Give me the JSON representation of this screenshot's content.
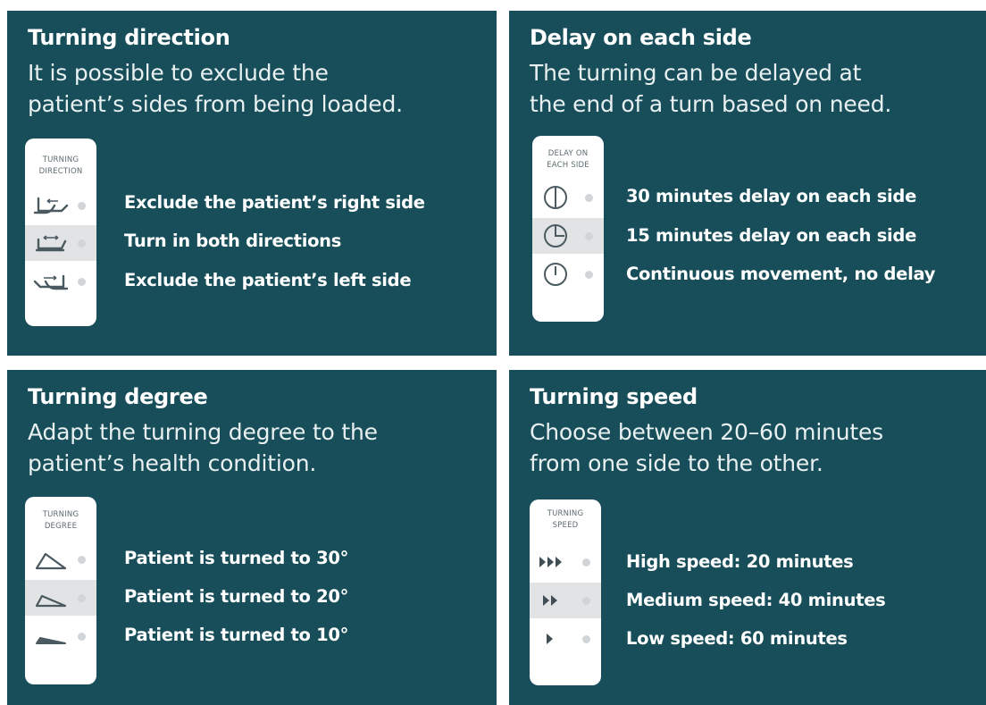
{
  "panels": {
    "direction": {
      "title": "Turning direction",
      "desc": [
        "It is possible to exclude the",
        "patient’s sides from being loaded."
      ],
      "card_header": [
        "TURNING",
        "DIRECTION"
      ],
      "options": [
        {
          "label": "Exclude the patient’s right side",
          "icon": "bed-tilt-left-arrow-icon",
          "selected": false
        },
        {
          "label": "Turn in both directions",
          "icon": "bed-both-arrows-icon",
          "selected": true
        },
        {
          "label": "Exclude the patient’s left side",
          "icon": "bed-tilt-right-arrow-icon",
          "selected": false
        }
      ]
    },
    "delay": {
      "title": "Delay on each side",
      "desc": [
        "The turning  can be delayed  at",
        "the end of a turn based on need."
      ],
      "card_header": [
        "DELAY ON",
        "EACH SIDE"
      ],
      "options": [
        {
          "label": "30 minutes delay on each side",
          "icon": "clock-30-icon",
          "selected": false
        },
        {
          "label": "15 minutes delay on each side",
          "icon": "clock-15-icon",
          "selected": true
        },
        {
          "label": "Continuous movement, no delay",
          "icon": "clock-0-icon",
          "selected": false
        }
      ]
    },
    "degree": {
      "title": "Turning degree",
      "desc": [
        "Adapt the turning degree to the",
        "patient’s health condition."
      ],
      "card_header": [
        "TURNING",
        "DEGREE"
      ],
      "options": [
        {
          "label": "Patient is turned to 30°",
          "icon": "angle-30-icon",
          "selected": false
        },
        {
          "label": "Patient is turned to 20°",
          "icon": "angle-20-icon",
          "selected": true
        },
        {
          "label": "Patient is turned to 10°",
          "icon": "angle-10-icon",
          "selected": false
        }
      ]
    },
    "speed": {
      "title": "Turning speed",
      "desc": [
        "Choose between 20–60 minutes",
        "from one side to the other."
      ],
      "card_header": [
        "TURNING",
        "SPEED"
      ],
      "options": [
        {
          "label": "High speed: 20 minutes",
          "icon": "triple-chevron-icon",
          "selected": false
        },
        {
          "label": "Medium speed: 40 minutes",
          "icon": "double-chevron-icon",
          "selected": true
        },
        {
          "label": "Low speed: 60 minutes",
          "icon": "single-chevron-icon",
          "selected": false
        }
      ]
    }
  },
  "colors": {
    "panel_bg": "#174e59",
    "card_bg": "#ffffff",
    "selected_row": "#e2e3e5",
    "icon_stroke": "#4a5a60",
    "indicator_dot": "#d2d5d7"
  }
}
